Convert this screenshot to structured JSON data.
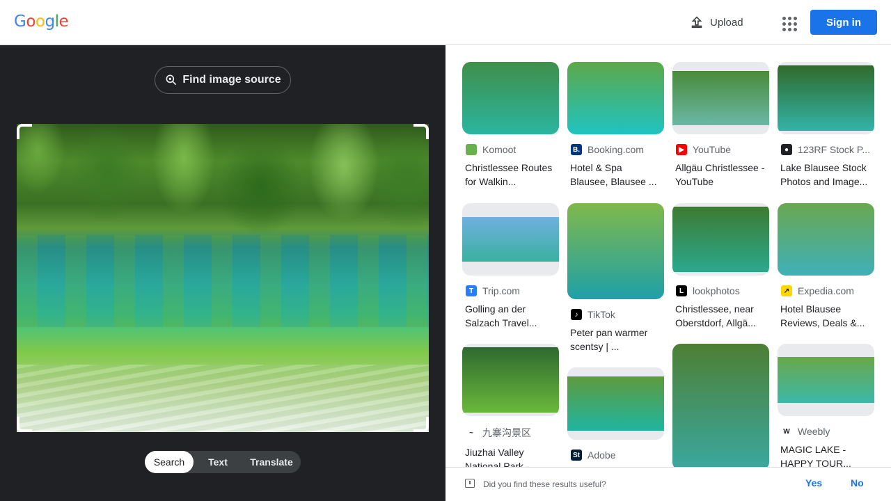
{
  "header": {
    "logo_letters": [
      {
        "ch": "G",
        "color": "#4285F4"
      },
      {
        "ch": "o",
        "color": "#EA4335"
      },
      {
        "ch": "o",
        "color": "#FBBC05"
      },
      {
        "ch": "g",
        "color": "#4285F4"
      },
      {
        "ch": "l",
        "color": "#34A853"
      },
      {
        "ch": "e",
        "color": "#EA4335"
      }
    ],
    "upload_label": "Upload",
    "signin_label": "Sign in"
  },
  "left": {
    "find_source_label": "Find image source",
    "modes": [
      {
        "label": "Search",
        "active": true
      },
      {
        "label": "Text",
        "active": false
      },
      {
        "label": "Translate",
        "active": false
      }
    ]
  },
  "results": [
    {
      "source": "Komoot",
      "fav": "#6ab04c",
      "fav_char": "",
      "title": "Christlessee Routes for Walkin..."
    },
    {
      "source": "Booking.com",
      "fav": "#003580",
      "fav_char": "B.",
      "title": "Hotel & Spa Blausee, Blausee ..."
    },
    {
      "source": "YouTube",
      "fav": "#ff0000",
      "fav_char": "▶",
      "title": "Allgäu Christlessee - YouTube"
    },
    {
      "source": "123RF Stock P...",
      "fav": "#202124",
      "fav_char": "●",
      "title": "Lake Blausee Stock Photos and Image..."
    },
    {
      "source": "Trip.com",
      "fav": "#287dfa",
      "fav_char": "T",
      "title": "Golling an der Salzach Travel..."
    },
    {
      "source": "TikTok",
      "fav": "#000000",
      "fav_char": "♪",
      "title": "Peter pan warmer scentsy | ..."
    },
    {
      "source": "lookphotos",
      "fav": "#000000",
      "fav_char": "L",
      "title": "Christlessee, near Oberstdorf, Allgä..."
    },
    {
      "source": "Expedia.com",
      "fav": "#ffd700",
      "fav_char": "↗",
      "title": "Hotel Blausee Reviews, Deals &..."
    },
    {
      "source": "九寨沟景区",
      "fav": "#ffffff",
      "fav_char": "~",
      "title": "Jiuzhai Valley National Park -..."
    },
    {
      "source": "Adobe",
      "fav": "#001e36",
      "fav_char": "St",
      "title": ""
    },
    {
      "source": "",
      "fav": "",
      "fav_char": "",
      "title": ""
    },
    {
      "source": "Weebly",
      "fav": "#ffffff",
      "fav_char": "W",
      "title": "MAGIC LAKE - HAPPY TOUR..."
    }
  ],
  "feedback": {
    "question": "Did you find these results useful?",
    "yes": "Yes",
    "no": "No"
  }
}
